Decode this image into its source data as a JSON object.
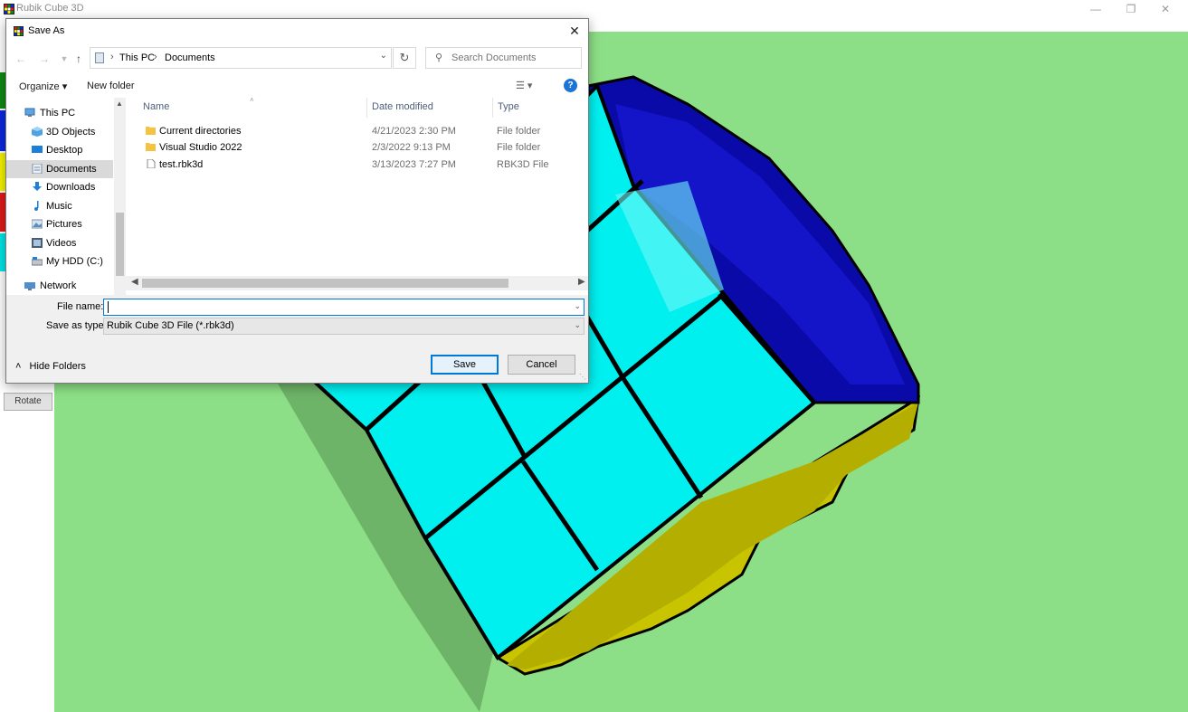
{
  "app": {
    "title": "Rubik Cube 3D",
    "icons": {
      "app": "rubik-app-icon",
      "minimize": "minimize-icon",
      "restore": "restore-icon",
      "close": "close-icon"
    },
    "side_panel": {
      "color_strips": [
        "#0f8a14",
        "#0b28e0",
        "#f4f400",
        "#e01a1a",
        "#00e6e6"
      ],
      "rotate_label": "Rotate"
    },
    "colors": {
      "background": "#8ddf87",
      "shadow": "#6db368",
      "face_cyan": "#00efef",
      "face_blue": "#0a0aa8",
      "face_yellow": "#c9c400",
      "edges": "#000000"
    }
  },
  "dialog": {
    "title": "Save As",
    "nav": {
      "back_icon": "back-arrow-icon",
      "forward_icon": "forward-arrow-icon",
      "recent_icon": "chevron-down-icon",
      "up_icon": "up-arrow-icon",
      "refresh_icon": "refresh-icon"
    },
    "breadcrumb": [
      "This PC",
      "Documents"
    ],
    "search": {
      "placeholder": "Search Documents"
    },
    "toolbar": {
      "organize": "Organize ▾",
      "new_folder": "New folder"
    },
    "nav_pane": [
      {
        "label": "This PC",
        "icon": "computer-icon",
        "level": 0
      },
      {
        "label": "3D Objects",
        "icon": "3d-objects-icon",
        "level": 1
      },
      {
        "label": "Desktop",
        "icon": "desktop-icon",
        "level": 1
      },
      {
        "label": "Documents",
        "icon": "documents-icon",
        "level": 1,
        "selected": true
      },
      {
        "label": "Downloads",
        "icon": "downloads-icon",
        "level": 1
      },
      {
        "label": "Music",
        "icon": "music-icon",
        "level": 1
      },
      {
        "label": "Pictures",
        "icon": "pictures-icon",
        "level": 1
      },
      {
        "label": "Videos",
        "icon": "videos-icon",
        "level": 1
      },
      {
        "label": "My HDD (C:)",
        "icon": "drive-icon",
        "level": 1
      },
      {
        "label": "Network",
        "icon": "network-icon",
        "level": 0
      }
    ],
    "columns": [
      "Name",
      "Date modified",
      "Type"
    ],
    "files": [
      {
        "name": "Current directories",
        "date": "4/21/2023 2:30 PM",
        "type": "File folder",
        "icon": "folder-icon"
      },
      {
        "name": "Visual Studio 2022",
        "date": "2/3/2022 9:13 PM",
        "type": "File folder",
        "icon": "folder-icon"
      },
      {
        "name": "test.rbk3d",
        "date": "3/13/2023 7:27 PM",
        "type": "RBK3D File",
        "icon": "file-icon"
      }
    ],
    "file_name_label": "File name:",
    "file_name_value": "",
    "save_type_label": "Save as type:",
    "save_type_value": "Rubik Cube 3D File (*.rbk3d)",
    "hide_folders": "Hide Folders",
    "save": "Save",
    "cancel": "Cancel"
  }
}
